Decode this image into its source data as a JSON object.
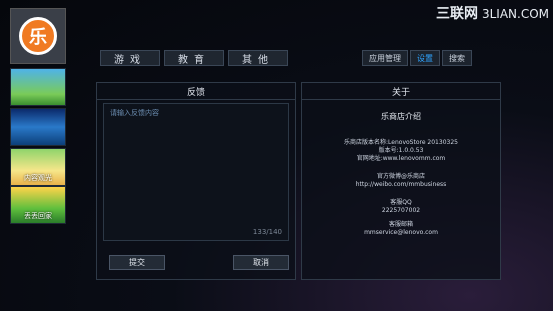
{
  "watermark": {
    "main": "三联网",
    "sub": "3LIAN.COM"
  },
  "sidebar": {
    "logo_glyph": "乐",
    "thumbnails": [
      {
        "label": ""
      },
      {
        "label": ""
      },
      {
        "label": "内容观光"
      },
      {
        "label": "丢丢回家"
      }
    ]
  },
  "tabs": [
    "游戏",
    "教育",
    "其他"
  ],
  "right_tabs": [
    {
      "label": "应用管理",
      "active": false
    },
    {
      "label": "设置",
      "active": true
    },
    {
      "label": "搜索",
      "active": false
    }
  ],
  "feedback": {
    "title": "反馈",
    "placeholder": "请输入反馈内容",
    "counter": "133/140",
    "submit_label": "提交",
    "cancel_label": "取消"
  },
  "about": {
    "title": "关于",
    "intro_title": "乐商店介绍",
    "version_full": "乐商店版本名称:LenovoStore 20130325",
    "version_num": "版本号:1.0.0.53",
    "website": "官网地址:www.lenovomm.com",
    "weibo_label": "官方微博@乐商店",
    "weibo_url": "http://weibo.com/mmbusiness",
    "qq_label": "客服QQ",
    "qq_number": "2225707002",
    "email_label": "客服邮箱",
    "email": "mmservice@lenovo.com"
  }
}
